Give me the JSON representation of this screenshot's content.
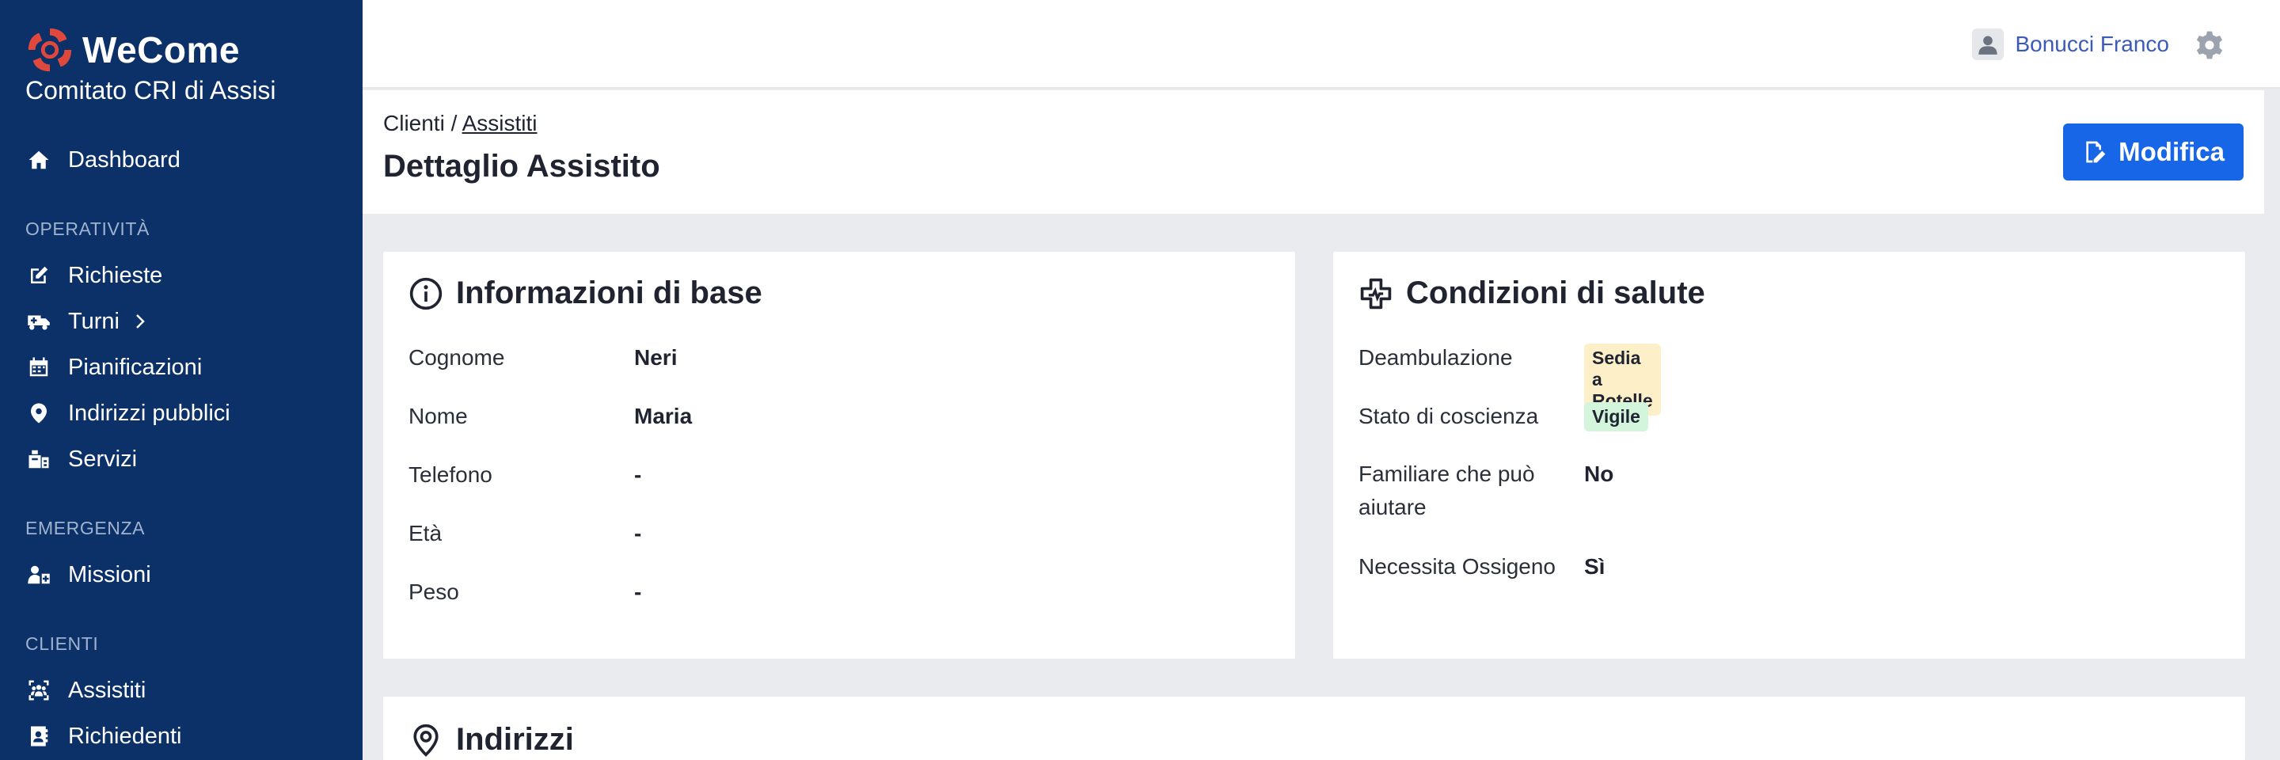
{
  "brand": {
    "name": "WeCome",
    "org": "Comitato CRI di Assisi"
  },
  "sidebar": {
    "dashboard": "Dashboard",
    "sections": {
      "operativita": "OPERATIVITÀ",
      "emergenza": "EMERGENZA",
      "clienti": "CLIENTI"
    },
    "items": {
      "richieste": "Richieste",
      "turni": "Turni",
      "pianificazioni": "Pianificazioni",
      "indirizzi": "Indirizzi pubblici",
      "servizi": "Servizi",
      "missioni": "Missioni",
      "assistiti": "Assistiti",
      "richiedenti": "Richiedenti"
    }
  },
  "topbar": {
    "user_name": "Bonucci Franco"
  },
  "header": {
    "breadcrumb_root": "Clienti",
    "breadcrumb_sep": "/",
    "breadcrumb_current": "Assistiti",
    "title": "Dettaglio Assistito",
    "edit_label": "Modifica"
  },
  "info": {
    "title": "Informazioni di base",
    "cognome_label": "Cognome",
    "cognome": "Neri",
    "nome_label": "Nome",
    "nome": "Maria",
    "telefono_label": "Telefono",
    "telefono": "-",
    "eta_label": "Età",
    "eta": "-",
    "peso_label": "Peso",
    "peso": "-"
  },
  "health": {
    "title": "Condizioni di salute",
    "deambulazione_label": "Deambulazione",
    "deambulazione": "Sedia a Rotelle",
    "coscienza_label": "Stato di coscienza",
    "coscienza": "Vigile",
    "familiare_label_1": "Familiare che può",
    "familiare_label_2": "aiutare",
    "familiare": "No",
    "ossigeno_label": "Necessita Ossigeno",
    "ossigeno": "Sì",
    "colors": {
      "badge_yellow": "#fdefc8",
      "badge_green": "#d3f5dc"
    }
  },
  "addresses": {
    "title": "Indirizzi"
  },
  "theme": {
    "sidebar": "#0b3168",
    "accent": "#1766e8",
    "brand_red": "#e0483e"
  }
}
